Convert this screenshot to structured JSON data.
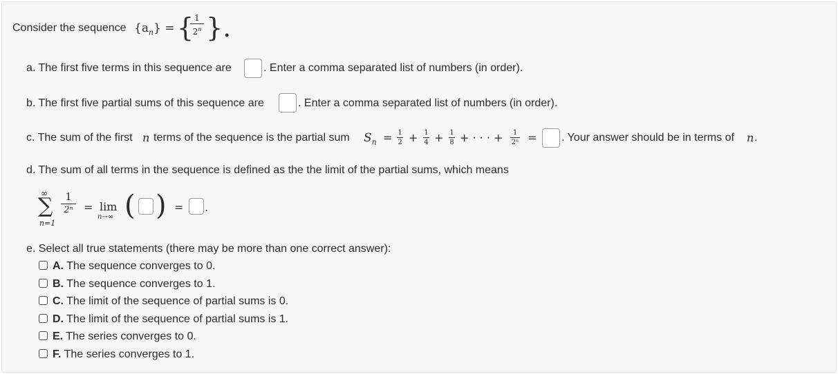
{
  "intro": {
    "text": "Consider the sequence",
    "seq": "{a",
    "seq_sub": "n",
    "seq_close": "} =",
    "brace_open": "{",
    "frac_num": "1",
    "frac_den": "2",
    "frac_den_exp": "n",
    "brace_close": "}."
  },
  "part_a": {
    "label": "a. The first five terms in this sequence are",
    "hint": ". Enter a comma separated list of numbers (in order)."
  },
  "part_b": {
    "label": "b. The first five partial sums of this sequence are",
    "hint": ". Enter a comma separated list of numbers (in order)."
  },
  "part_c": {
    "label_pre": "c. The sum of the first",
    "n": "n",
    "label_mid": "terms of the sequence is the partial sum",
    "S": "S",
    "S_sub": "n",
    "eq": "=",
    "f1_num": "1",
    "f1_den": "2",
    "plus1": "+",
    "f2_num": "1",
    "f2_den": "4",
    "plus2": "+",
    "f3_num": "1",
    "f3_den": "8",
    "plus3": "+ · · · +",
    "f4_num": "1",
    "f4_den": "2ⁿ",
    "eq2": "=",
    "hint": ". Your answer should be in terms of",
    "hint_n": "n",
    "hint_end": "."
  },
  "part_d": {
    "label": "d. The sum of all terms in the sequence is defined as the the limit of the partial sums, which means",
    "sum_top": "∞",
    "sigma": "∑",
    "sum_bottom": "n=1",
    "frac_num": "1",
    "frac_den": "2ⁿ",
    "eq": "=",
    "lim": "lim",
    "lim_sub": "n→∞",
    "paren_open": "(",
    "paren_close": ")",
    "eq2": "=",
    "end": "."
  },
  "part_e": {
    "label": "e. Select all true statements (there may be more than one correct answer):",
    "options": [
      {
        "letter": "A.",
        "text": "The sequence converges to 0."
      },
      {
        "letter": "B.",
        "text": "The sequence converges to 1."
      },
      {
        "letter": "C.",
        "text": "The limit of the sequence of partial sums is 0."
      },
      {
        "letter": "D.",
        "text": "The limit of the sequence of partial sums is 1."
      },
      {
        "letter": "E.",
        "text": "The series converges to 0."
      },
      {
        "letter": "F.",
        "text": "The series converges to 1."
      }
    ]
  }
}
